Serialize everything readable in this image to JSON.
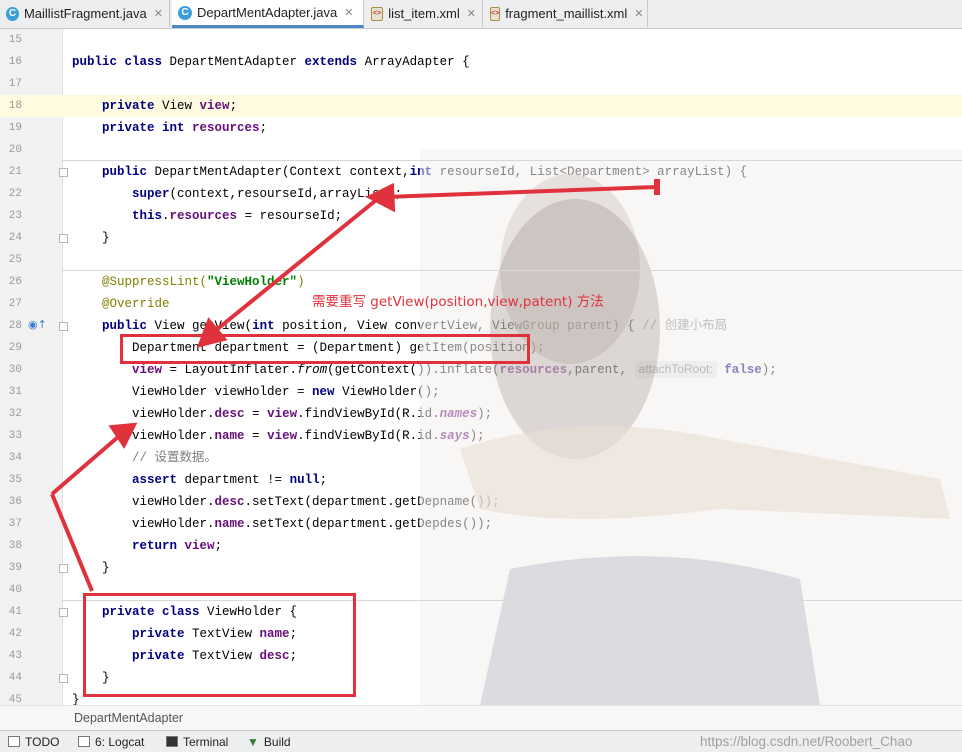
{
  "tabs": [
    {
      "label": "MaillistFragment.java",
      "icon": "java-class-icon",
      "active": false
    },
    {
      "label": "DepartMentAdapter.java",
      "icon": "java-class-icon",
      "active": true
    },
    {
      "label": "list_item.xml",
      "icon": "xml-file-icon",
      "active": false
    },
    {
      "label": "fragment_maillist.xml",
      "icon": "xml-file-icon",
      "active": false
    }
  ],
  "editor": {
    "line_numbers": [
      "15",
      "16",
      "17",
      "18",
      "19",
      "20",
      "21",
      "22",
      "23",
      "24",
      "25",
      "26",
      "27",
      "28",
      "29",
      "30",
      "31",
      "32",
      "33",
      "34",
      "35",
      "36",
      "37",
      "38",
      "39",
      "40",
      "41",
      "42",
      "43",
      "44",
      "45"
    ],
    "param_hint": "attachToRoot:",
    "annotation_text": "需要重写 getView(position,view,patent) 方法"
  },
  "breadcrumb": "DepartMentAdapter",
  "bottom_tools": [
    {
      "label": "TODO",
      "icon": "todo-icon"
    },
    {
      "label": "6: Logcat",
      "icon": "logcat-icon"
    },
    {
      "label": "Terminal",
      "icon": "terminal-icon"
    },
    {
      "label": "Build",
      "icon": "build-icon"
    }
  ],
  "watermark": "https://blog.csdn.net/Roobert_Chao",
  "colors": {
    "keyword": "#000080",
    "field": "#660e7a",
    "annotation_red": "#e0323c",
    "active_tab_accent": "#4a88c7"
  }
}
